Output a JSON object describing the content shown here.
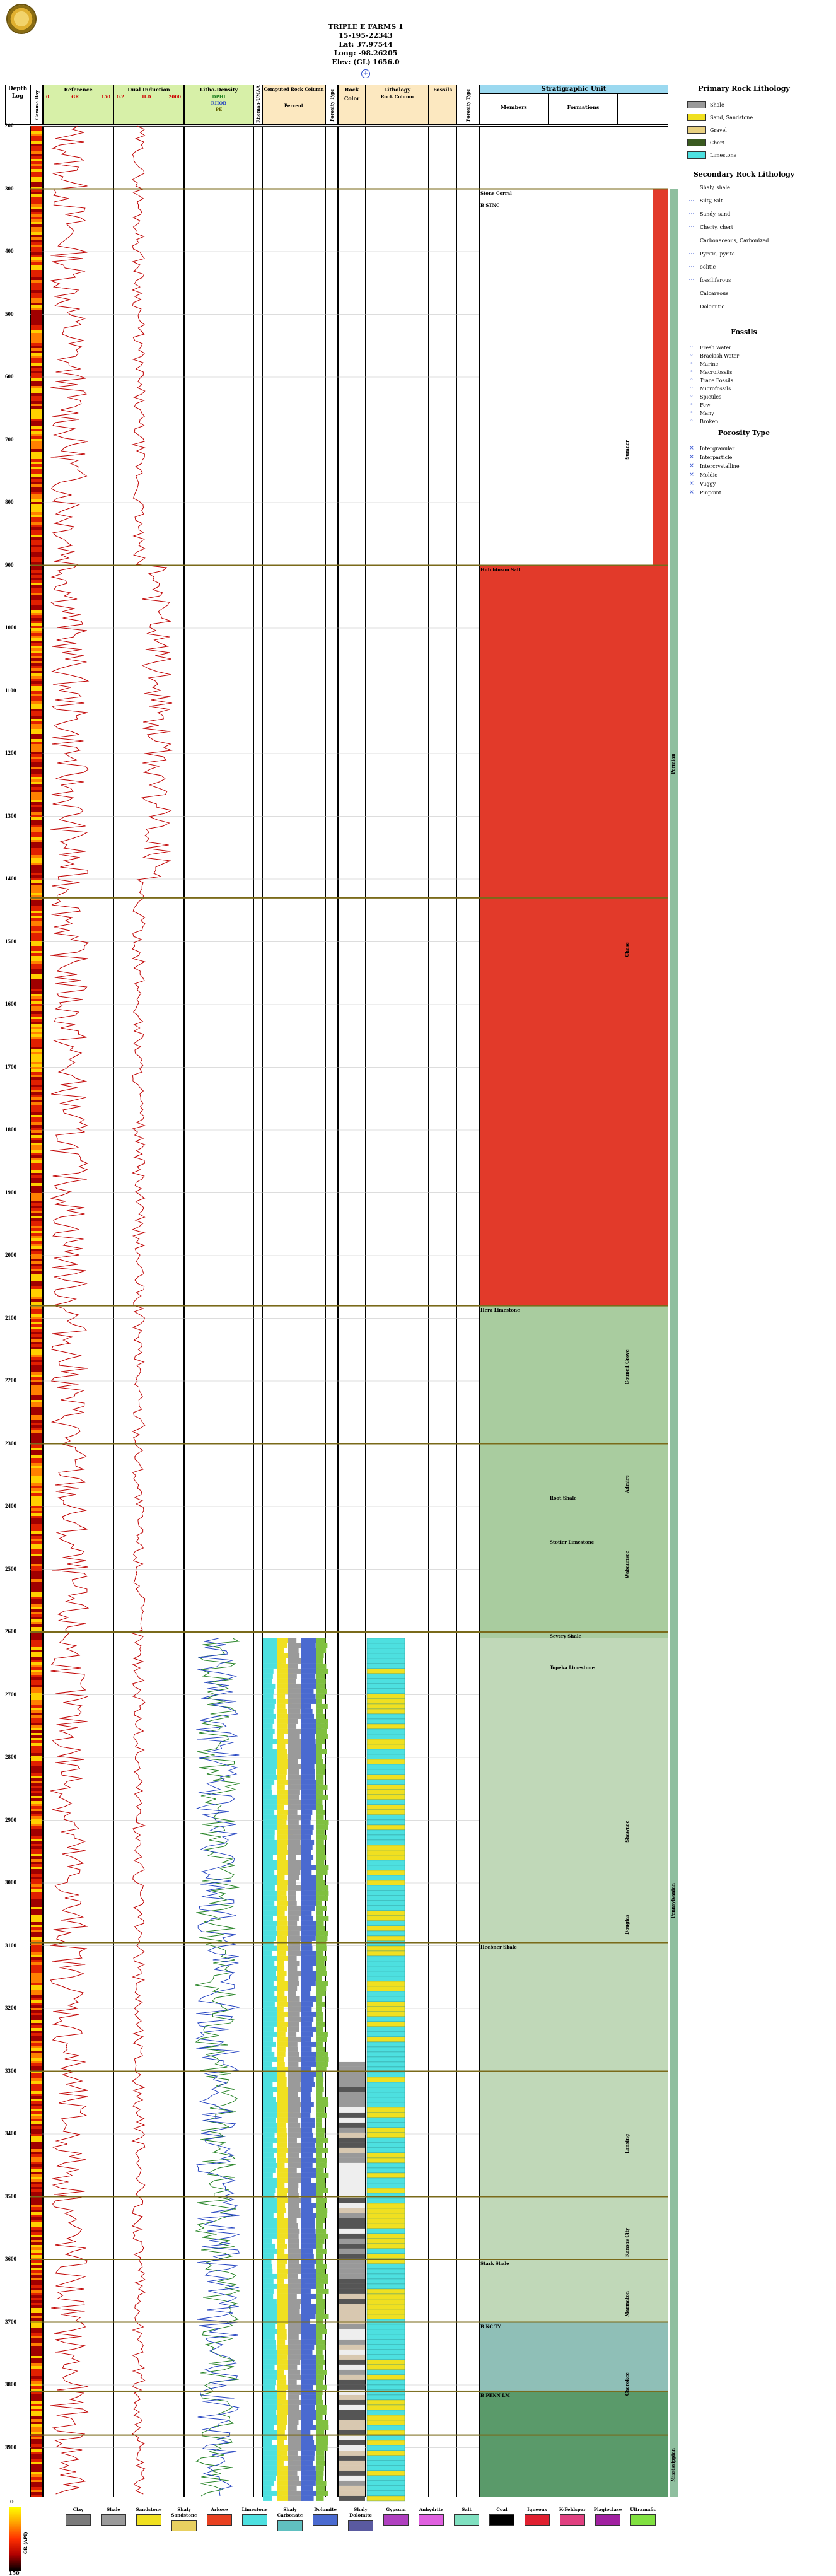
{
  "header": {
    "well_name": "TRIPLE E FARMS 1",
    "api": "15-195-22343",
    "lat": "Lat: 37.97544",
    "long": "Long: -98.26205",
    "elev": "Elev: (GL) 1656.0"
  },
  "columns": {
    "depth_log": "Depth Log",
    "gamma": "Gamma Ray",
    "reference": "Reference",
    "gr": "GR",
    "gr_left": "0",
    "gr_right": "150",
    "dual_induction": "Dual Induction",
    "ild": "ILD",
    "ild_left": "0.2",
    "ild_right": "2000",
    "litho_density": "Litho-Density",
    "dphi": "DPHI",
    "rhob": "RHOB",
    "pe": "PE",
    "rhomaa": "Rhomaa-UMAA",
    "computed_lith": "Computed Rock Column",
    "percent": "Percent",
    "porosity_type": "Porosity Type",
    "rock_color": "Rock Color",
    "lithology": "Lithology",
    "rock_column": "Rock Column",
    "fossils": "Fossils",
    "strat_unit": "Stratigraphic Unit",
    "members": "Members",
    "formations": "Formations"
  },
  "depths": [
    "200",
    "300",
    "400",
    "500",
    "600",
    "700",
    "800",
    "900",
    "1000",
    "1100",
    "1200",
    "1300",
    "1400",
    "1500",
    "1600",
    "1700",
    "1800",
    "1900",
    "2000",
    "2100",
    "2200",
    "2300",
    "2400",
    "2500",
    "2600",
    "2700",
    "2800",
    "2900",
    "3000",
    "3100",
    "3200",
    "3300",
    "3400",
    "3500",
    "3600",
    "3700",
    "3800",
    "3900"
  ],
  "members": [
    {
      "name": "Stone Corral",
      "depth": "300"
    },
    {
      "name": "B STNC",
      "depth": "320"
    },
    {
      "name": "Hutchinson Salt",
      "depth": "900"
    },
    {
      "name": "Hera Limestone",
      "depth": "2080"
    },
    {
      "name": "Heebner Shale",
      "depth": "3095"
    },
    {
      "name": "Stark Shale",
      "depth": "3600"
    },
    {
      "name": "B KC TY",
      "depth": "3700"
    },
    {
      "name": "B PENN LM",
      "depth": "3810"
    }
  ],
  "formations": [
    {
      "name": "Root Shale",
      "depth": "2380"
    },
    {
      "name": "Stotler Limestone",
      "depth": "2450"
    },
    {
      "name": "Severy Shale",
      "depth": "2600"
    },
    {
      "name": "Topeka Limestone",
      "depth": "2650"
    }
  ],
  "groups": [
    "Sumner",
    "Chase",
    "Council Grove",
    "Admire",
    "Wabaunsee",
    "Shawnee",
    "Douglas",
    "Lansing",
    "Kansas City",
    "Marmaton",
    "Cherokee"
  ],
  "systems": [
    "Permian",
    "Pennsylvanian",
    "Mississippian"
  ],
  "legend": {
    "primary_title": "Primary Rock Lithology",
    "primary": [
      {
        "label": "Shale",
        "color": "#9a9a9a"
      },
      {
        "label": "Sand, Sandstone",
        "color": "#f0e020"
      },
      {
        "label": "Gravel",
        "color": "#e8d080"
      },
      {
        "label": "Chert",
        "color": "#3a5a20"
      },
      {
        "label": "Limestone",
        "color": "#4de0e0"
      }
    ],
    "secondary_title": "Secondary Rock Lithology",
    "secondary": [
      "Shaly, shale",
      "Silty, Silt",
      "Sandy, sand",
      "Cherty, chert",
      "Carbonaceous, Carbonized",
      "Pyritic, pyrite",
      "oolitic",
      "fossiliferous",
      "Calcareous",
      "Dolomitic"
    ],
    "fossils_title": "Fossils",
    "fossils": [
      "Fresh Water",
      "Brackish Water",
      "Marine",
      "Macrofossils",
      "Trace Fossils",
      "Microfossils",
      "Spicules",
      "Few",
      "Many",
      "Broken"
    ],
    "porosity_title": "Porosity Type",
    "porosity": [
      "Intergranular",
      "Interparticle",
      "Intercrystalline",
      "Moldic",
      "Vuggy",
      "Pinpoint"
    ]
  },
  "bottom_legend": [
    {
      "label": "Clay",
      "color": "#7a7a7a"
    },
    {
      "label": "Shale",
      "color": "#9a9a9a"
    },
    {
      "label": "Sandstone",
      "color": "#f0e020"
    },
    {
      "label": "Shaly Sandstone",
      "color": "#e8d060"
    },
    {
      "label": "Arkose",
      "color": "#e84020"
    },
    {
      "label": "Limestone",
      "color": "#4de0e0"
    },
    {
      "label": "Shaly Carbonate",
      "color": "#60c0c0"
    },
    {
      "label": "Dolomite",
      "color": "#4a6ad0"
    },
    {
      "label": "Shaly Dolomite",
      "color": "#5a5aa0"
    },
    {
      "label": "Gypsum",
      "color": "#b040c0"
    },
    {
      "label": "Anhydrite",
      "color": "#e060e0"
    },
    {
      "label": "Salt",
      "color": "#80e0c0"
    },
    {
      "label": "Coal",
      "color": "#000000"
    },
    {
      "label": "Igneous",
      "color": "#e02030"
    },
    {
      "label": "K-Feldspar",
      "color": "#e04080"
    },
    {
      "label": "Plagioclase",
      "color": "#a020a0"
    },
    {
      "label": "Ultramafic",
      "color": "#80e040"
    }
  ],
  "gr_scale": {
    "label": "GR (API)",
    "min": "0",
    "max": "150"
  },
  "colors": {
    "salt": "#e23a2a",
    "permian_green": "#a9cc9f",
    "penn_teal": "#8fbfb7",
    "deep_green": "#5a9a6a",
    "strat_header": "#9bd9f0",
    "separator": "#7a6a1a"
  }
}
